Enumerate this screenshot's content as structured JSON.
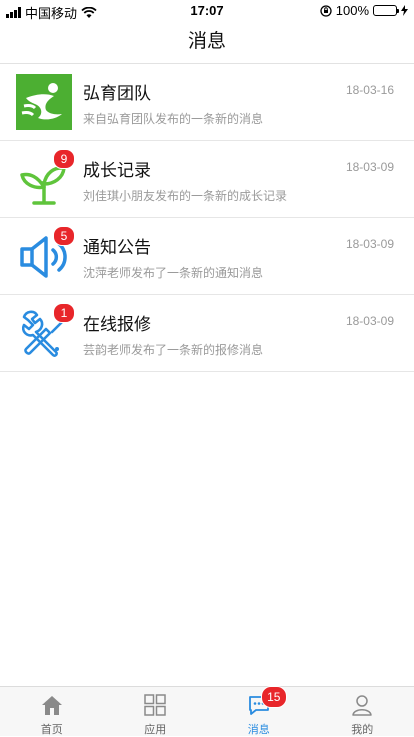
{
  "status_bar": {
    "carrier": "中国移动",
    "time": "17:07",
    "battery_pct": "100%",
    "battery_level": 1.0,
    "icons": [
      "signal-icon",
      "wifi-icon",
      "orientation-lock-icon",
      "battery-icon",
      "charging-icon"
    ]
  },
  "nav": {
    "title": "消息"
  },
  "messages": [
    {
      "title": "弘育团队",
      "subtitle": "来自弘育团队发布的一条新的消息",
      "date": "18-03-16",
      "badge": "",
      "icon": "team-logo-icon"
    },
    {
      "title": "成长记录",
      "subtitle": "刘佳琪小朋友发布的一条新的成长记录",
      "date": "18-03-09",
      "badge": "9",
      "icon": "sprout-icon"
    },
    {
      "title": "通知公告",
      "subtitle": "沈萍老师发布了一条新的通知消息",
      "date": "18-03-09",
      "badge": "5",
      "icon": "speaker-icon"
    },
    {
      "title": "在线报修",
      "subtitle": "芸韵老师发布了一条新的报修消息",
      "date": "18-03-09",
      "badge": "1",
      "icon": "repair-tools-icon"
    }
  ],
  "tabs": [
    {
      "label": "首页",
      "icon": "home-icon"
    },
    {
      "label": "应用",
      "icon": "apps-grid-icon"
    },
    {
      "label": "消息",
      "icon": "chat-icon",
      "badge": "15",
      "active": true
    },
    {
      "label": "我的",
      "icon": "profile-icon"
    }
  ],
  "colors": {
    "accent": "#2a8ce0",
    "badge": "#e8262a",
    "brand_green": "#4caf32",
    "sprout_green": "#5fc43b"
  }
}
